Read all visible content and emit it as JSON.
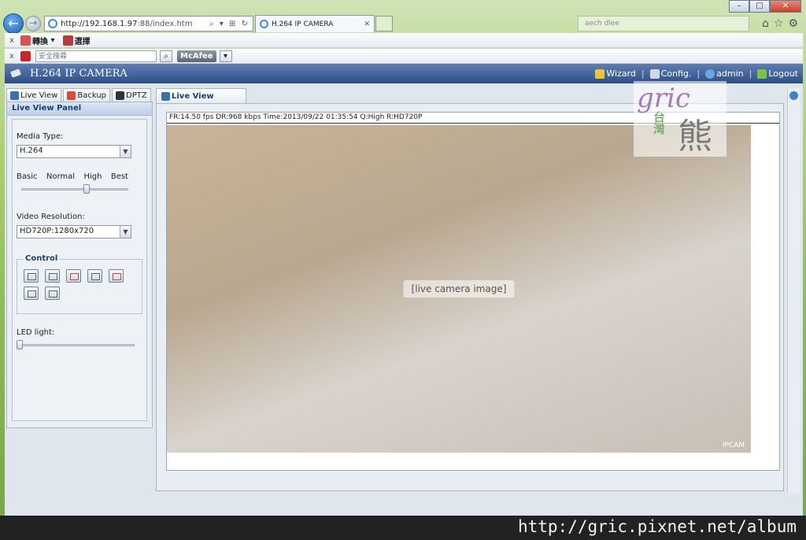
{
  "browser": {
    "address_host": "http://192.168.1.97",
    "address_rest": ":88/index.htm",
    "address_tools": "⌕ ▾ ⊞ ↻",
    "tab_title": "H.264 IP CAMERA",
    "tab_close": "✕",
    "ghost_tab": "aech dlee",
    "toolbar1": {
      "translate": "轉換",
      "select": "選擇"
    },
    "toolbar2": {
      "search_placeholder": "安全搜尋",
      "mcafee": "McAfee"
    }
  },
  "app": {
    "title": "H.264 IP CAMERA",
    "menu": {
      "wizard": "Wizard",
      "config": "Config.",
      "admin": "admin",
      "logout": "Logout",
      "sep": "|"
    }
  },
  "left_tabs": [
    "Live View",
    "Backup",
    "DPTZ"
  ],
  "panel": {
    "title": "Live View Panel",
    "media_type_label": "Media Type:",
    "media_type_value": "H.264",
    "quality_labels": [
      "Basic",
      "Normal",
      "High",
      "Best"
    ],
    "quality_level": "High",
    "video_resolution_label": "Video Resolution:",
    "video_resolution_value": "HD720P:1280x720",
    "control_label": "Control",
    "led_label": "LED light:",
    "led_level": 0
  },
  "main": {
    "tab": "Live View",
    "osd": "FR:14.50 fps  DR:968 kbps Time:2013/09/22 01:35:54 Q:High R:HD720P",
    "camera_stamp": "IPCAM"
  },
  "watermark": {
    "w1": "gric",
    "w2": "台灣",
    "w3": "熊"
  },
  "footer": "http://gric.pixnet.net/album",
  "colors": {
    "appbar": "#3d5d94",
    "accent": "#1c3f74"
  }
}
